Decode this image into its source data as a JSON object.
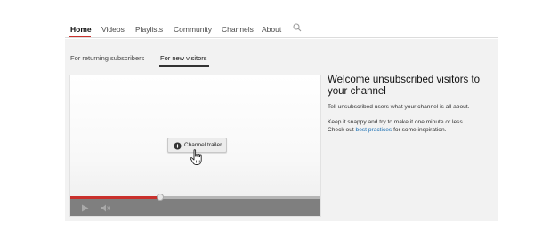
{
  "nav": {
    "items": [
      {
        "label": "Home",
        "active": true
      },
      {
        "label": "Videos",
        "active": false
      },
      {
        "label": "Playlists",
        "active": false
      },
      {
        "label": "Community",
        "active": false
      },
      {
        "label": "Channels",
        "active": false
      },
      {
        "label": "About",
        "active": false
      }
    ],
    "search_icon": "search-icon",
    "accent_color": "#c9302c"
  },
  "subtabs": [
    {
      "label": "For returning subscribers",
      "active": false
    },
    {
      "label": "For new visitors",
      "active": true
    }
  ],
  "player": {
    "trailer_button_label": "Channel trailer",
    "trailer_button_icon": "plus-circle-icon",
    "progress_fraction": 0.36,
    "play_icon": "play-icon",
    "volume_icon": "volume-icon",
    "cursor_icon": "hand-cursor-icon"
  },
  "info": {
    "title": "Welcome unsubscribed visitors to your channel",
    "line1": "Tell unsubscribed users what your channel is all about.",
    "line2": "Keep it snappy and try to make it one minute or less.",
    "line3_prefix": "Check out",
    "line3_link": "best practices",
    "line3_suffix": "for some inspiration."
  }
}
